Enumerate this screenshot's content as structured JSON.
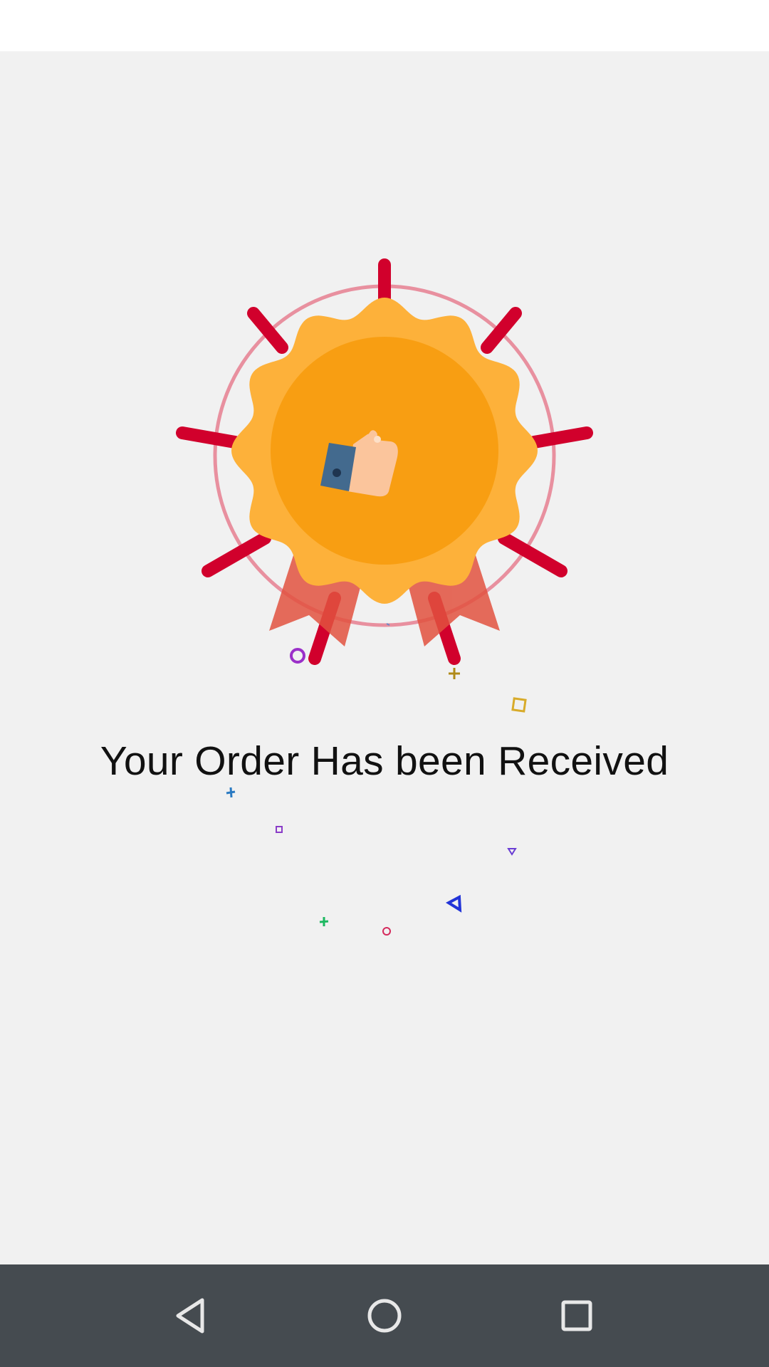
{
  "message": "Your Order Has been Received",
  "icons": {
    "badge": "thumbs-up-award-badge-icon",
    "nav_back": "back-triangle-icon",
    "nav_home": "home-circle-icon",
    "nav_recents": "recents-square-icon"
  },
  "colors": {
    "background": "#f1f1f1",
    "status_bar": "#ffffff",
    "nav_bar": "#454b50",
    "badge_outer": "#fdb13a",
    "badge_inner": "#f89e12",
    "rays": "#d1002c",
    "ribbons": "#e2523f"
  }
}
